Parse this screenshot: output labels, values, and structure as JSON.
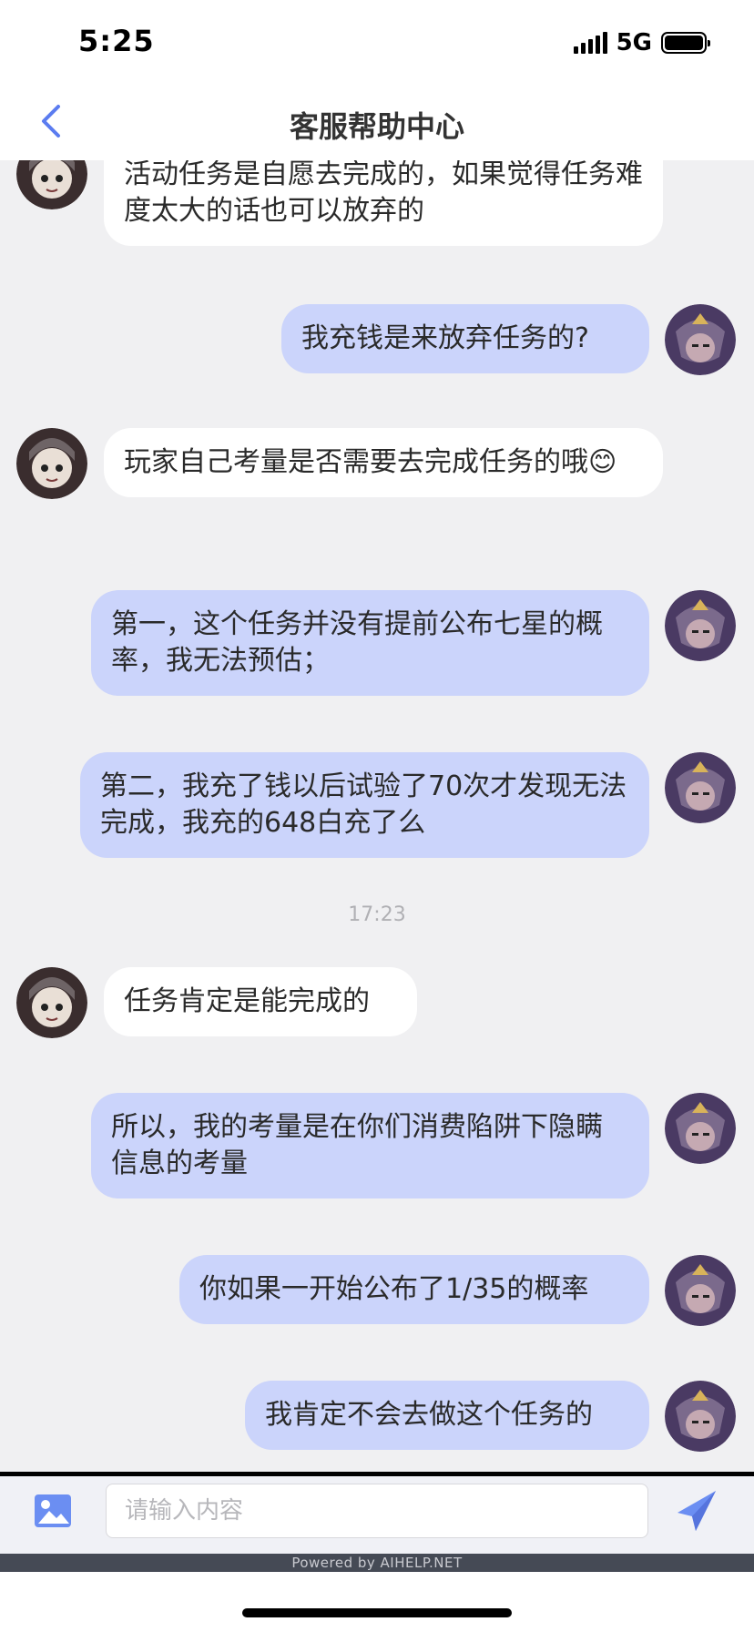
{
  "status_bar": {
    "time": "5:25",
    "network": "5G"
  },
  "nav": {
    "title": "客服帮助中心"
  },
  "messages": [
    {
      "side": "agent",
      "text": "活动任务是自愿去完成的，如果觉得任务难度太大的话也可以放弃的"
    },
    {
      "side": "user",
      "text": "我充钱是来放弃任务的?"
    },
    {
      "side": "agent",
      "text": "玩家自己考量是否需要去完成任务的哦😊"
    },
    {
      "side": "user",
      "text": "第一，这个任务并没有提前公布七星的概率，我无法预估；"
    },
    {
      "side": "user",
      "text": "第二，我充了钱以后试验了70次才发现无法完成，我充的648白充了么"
    },
    {
      "side": "agent",
      "text": "任务肯定是能完成的"
    },
    {
      "side": "user",
      "text": "所以，我的考量是在你们消费陷阱下隐瞒信息的考量"
    },
    {
      "side": "user",
      "text": "你如果一开始公布了1/35的概率"
    },
    {
      "side": "user",
      "text": "我肯定不会去做这个任务的"
    }
  ],
  "timestamp": "17:23",
  "input": {
    "placeholder": "请输入内容",
    "value": ""
  },
  "footer": {
    "powered_by": "Powered by AIHELP.NET"
  },
  "colors": {
    "accent": "#5b7cf0",
    "user_bubble": "#cbd4fb",
    "agent_bubble": "#ffffff",
    "chat_bg": "#f0f0f2"
  }
}
